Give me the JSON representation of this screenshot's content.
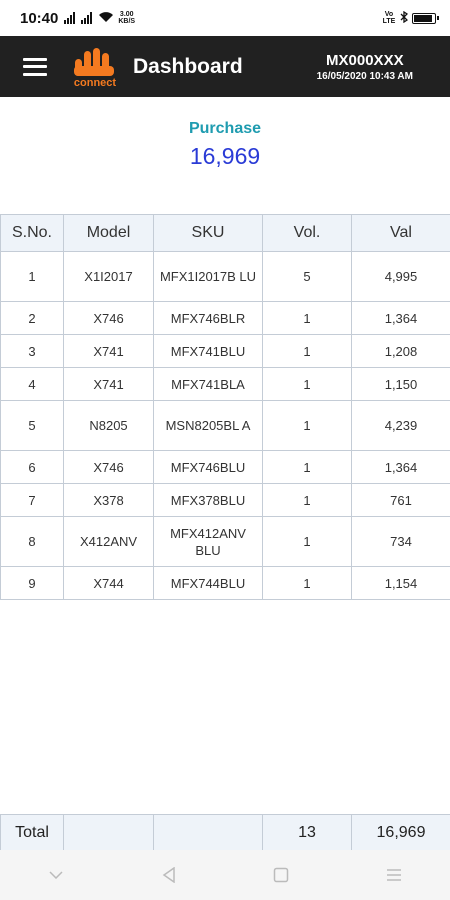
{
  "status_bar": {
    "time": "10:40",
    "net_speed_value": "3.00",
    "net_speed_unit": "KB/S",
    "volte": "Vo LTE"
  },
  "header": {
    "title": "Dashboard",
    "logo_text": "connect",
    "user_id": "MX000XXX",
    "datetime": "16/05/2020 10:43 AM"
  },
  "summary": {
    "label": "Purchase",
    "value": "16,969"
  },
  "table": {
    "headers": [
      "S.No.",
      "Model",
      "SKU",
      "Vol.",
      "Val"
    ],
    "rows": [
      [
        "1",
        "X1I2017",
        "MFX1I2017B LU",
        "5",
        "4,995"
      ],
      [
        "2",
        "X746",
        "MFX746BLR",
        "1",
        "1,364"
      ],
      [
        "3",
        "X741",
        "MFX741BLU",
        "1",
        "1,208"
      ],
      [
        "4",
        "X741",
        "MFX741BLA",
        "1",
        "1,150"
      ],
      [
        "5",
        "N8205",
        "MSN8205BL A",
        "1",
        "4,239"
      ],
      [
        "6",
        "X746",
        "MFX746BLU",
        "1",
        "1,364"
      ],
      [
        "7",
        "X378",
        "MFX378BLU",
        "1",
        "761"
      ],
      [
        "8",
        "X412ANV",
        "MFX412ANV BLU",
        "1",
        "734"
      ],
      [
        "9",
        "X744",
        "MFX744BLU",
        "1",
        "1,154"
      ]
    ]
  },
  "total": {
    "label": "Total",
    "volume": "13",
    "value": "16,969"
  },
  "colors": {
    "header_bg": "#212121",
    "brand_orange": "#f47a20",
    "summary_label": "#1f9cb0",
    "summary_value": "#2a3bd6",
    "table_header_bg": "#eef3f9"
  },
  "icons": {
    "menu": "hamburger-icon",
    "nav_down": "chevron-down-icon",
    "nav_back": "back-triangle-icon",
    "nav_home": "home-square-icon",
    "nav_recents": "menu-lines-icon"
  }
}
